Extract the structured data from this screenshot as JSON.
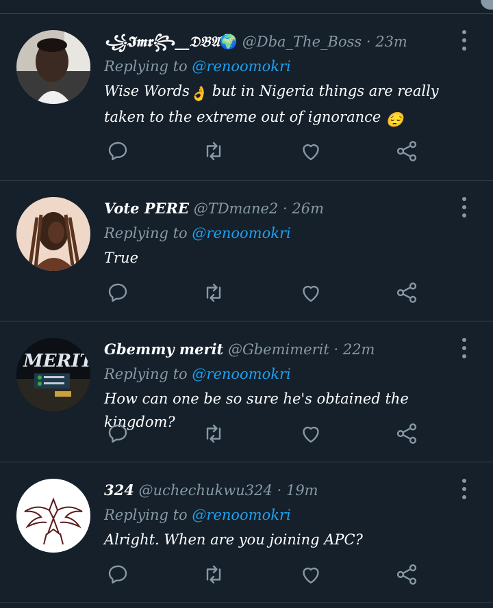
{
  "tweets": [
    {
      "name": "꧁𝕴𝖒𝖗꧂__𝔇𝔅𝔄",
      "globe": "🌍",
      "handle": "@Dba_The_Boss",
      "time": "23m",
      "replying_label": "Replying to",
      "reply_to": "@renoomokri",
      "text_part1": "Wise Words",
      "emoji1": "👌",
      "text_part2": "but in Nigeria things are really taken to the extreme out of ignorance",
      "emoji2": "😔"
    },
    {
      "name": "Vote PERE",
      "handle": "@TDmane2",
      "time": "26m",
      "replying_label": "Replying to",
      "reply_to": "@renoomokri",
      "text": "True"
    },
    {
      "name": "Gbemmy merit",
      "handle": "@Gbemimerit",
      "time": "22m",
      "replying_label": "Replying to",
      "reply_to": "@renoomokri",
      "text": "How can one be so sure he's obtained the kingdom?",
      "avatar_text": "MERIT"
    },
    {
      "name": "324",
      "handle": "@uchechukwu324",
      "time": "19m",
      "replying_label": "Replying to",
      "reply_to": "@renoomokri",
      "text": "Alright. When are you joining APC?"
    }
  ],
  "separator": "·",
  "icons": {
    "reply": "reply-icon",
    "retweet": "retweet-icon",
    "like": "like-icon",
    "share": "share-icon",
    "more": "more-icon"
  },
  "colors": {
    "background": "#15202b",
    "divider": "#38444d",
    "secondary": "#8899a6",
    "link": "#1da1f2"
  }
}
